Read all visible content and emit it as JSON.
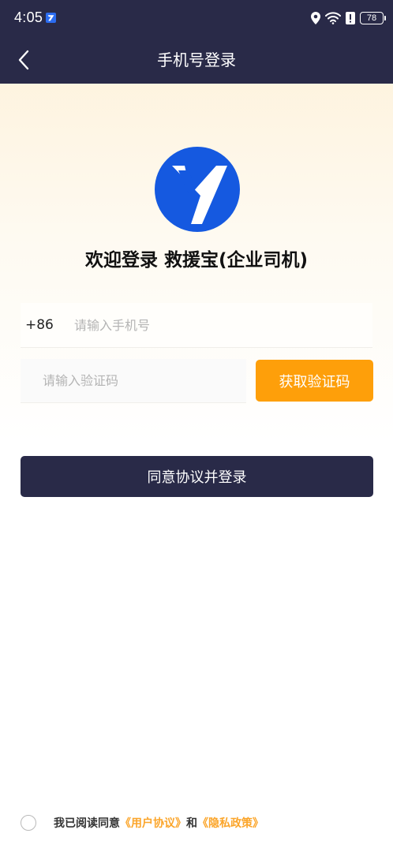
{
  "status_bar": {
    "time": "4:05",
    "battery": "78",
    "icons": [
      "app-icon",
      "location-icon",
      "wifi-icon",
      "alert-icon",
      "battery-icon"
    ]
  },
  "nav": {
    "title": "手机号登录",
    "back_icon": "chevron-left-icon"
  },
  "logo": {
    "icon": "app-logo-icon",
    "color": "#1559e0"
  },
  "welcome": "欢迎登录 救援宝(企业司机)",
  "phone": {
    "country_code": "+86",
    "placeholder": "请输入手机号",
    "value": ""
  },
  "code": {
    "placeholder": "请输入验证码",
    "value": "",
    "button_label": "获取验证码"
  },
  "login_button": "同意协议并登录",
  "agreement": {
    "prefix": "我已阅读同意",
    "user_agreement": "《用户协议》",
    "and": "和",
    "privacy_policy": "《隐私政策》",
    "checked": false
  },
  "colors": {
    "header": "#292a48",
    "accent": "#fe9f0a",
    "link": "#fba52a",
    "brand_blue": "#1559e0"
  }
}
